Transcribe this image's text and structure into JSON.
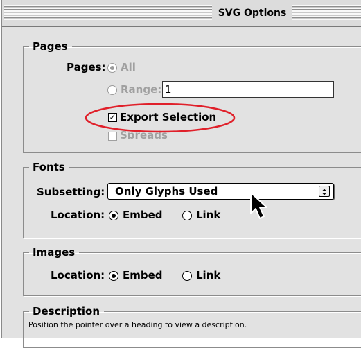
{
  "window": {
    "title": "SVG Options"
  },
  "pages": {
    "legend": "Pages",
    "pages_label": "Pages:",
    "all_label": "All",
    "range_label": "Range:",
    "range_value": "1",
    "export_selection_label": "Export Selection",
    "export_selection_checked": true,
    "spreads_label": "Spreads",
    "spreads_checked": false
  },
  "fonts": {
    "legend": "Fonts",
    "subsetting_label": "Subsetting:",
    "subsetting_value": "Only Glyphs Used",
    "location_label": "Location:",
    "embed_label": "Embed",
    "link_label": "Link",
    "selected": "Embed"
  },
  "images": {
    "legend": "Images",
    "location_label": "Location:",
    "embed_label": "Embed",
    "link_label": "Link",
    "selected": "Embed"
  },
  "description": {
    "legend": "Description",
    "text": "Position the pointer over a heading to view a description."
  },
  "colors": {
    "highlight_ellipse": "#e0202a",
    "panel": "#e2e2e2"
  },
  "icons": {
    "cursor": "arrow-pointer-icon"
  }
}
